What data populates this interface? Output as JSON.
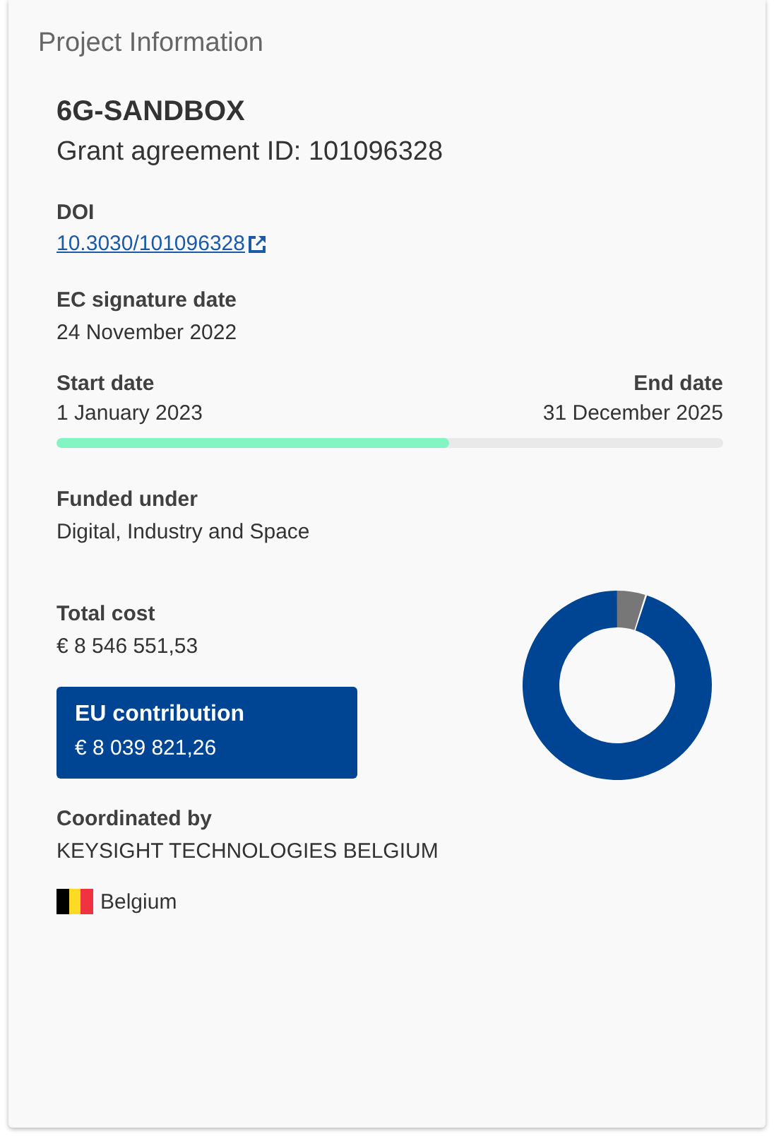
{
  "panel": {
    "title": "Project Information"
  },
  "project": {
    "acronym": "6G-SANDBOX",
    "grant": "Grant agreement ID: 101096328"
  },
  "doi": {
    "label": "DOI",
    "link": "10.3030/101096328"
  },
  "signature": {
    "label": "EC signature date",
    "value": "24 November 2022"
  },
  "duration": {
    "start_label": "Start date",
    "start": "1 January 2023",
    "end_label": "End date",
    "end": "31 December 2025",
    "level": 0.59
  },
  "funded": {
    "label": "Funded under",
    "value": "Digital, Industry and Space"
  },
  "cost": {
    "label": "Total cost",
    "value": "€ 8 546 551,53"
  },
  "contribution": {
    "label": "EU contribution",
    "value": "€ 8 039 821,26"
  },
  "coordinator": {
    "label": "Coordinated by",
    "name": "KEYSIGHT TECHNOLOGIES BELGIUM",
    "country": "Belgium"
  }
}
